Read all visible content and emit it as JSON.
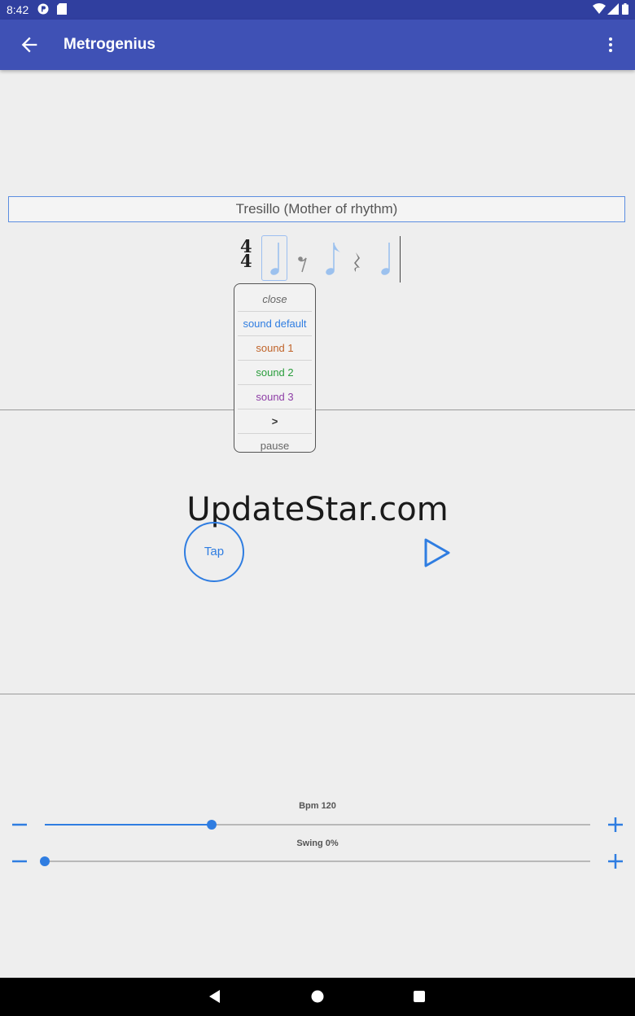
{
  "status_bar": {
    "time": "8:42"
  },
  "app_bar": {
    "title": "Metrogenius"
  },
  "rhythm": {
    "name": "Tresillo (Mother of rhythm)",
    "time_signature": {
      "top": "4",
      "bottom": "4"
    }
  },
  "sound_menu": {
    "items": [
      {
        "label": "close",
        "color": "#666666"
      },
      {
        "label": "sound default",
        "color": "#2f7de1"
      },
      {
        "label": "sound 1",
        "color": "#c0642a"
      },
      {
        "label": "sound 2",
        "color": "#2a9d3c"
      },
      {
        "label": "sound 3",
        "color": "#8e3ea6"
      },
      {
        "label": ">",
        "color": "#333333"
      },
      {
        "label": "pause",
        "color": "#666666"
      }
    ]
  },
  "watermark": "UpdateStar.com",
  "controls": {
    "tap_label": "Tap"
  },
  "sliders": {
    "bpm": {
      "label": "Bpm 120",
      "fraction": 0.306
    },
    "swing": {
      "label": "Swing 0%",
      "fraction": 0.0
    }
  },
  "colors": {
    "primary": "#3f51b5",
    "primary_dark": "#303f9f",
    "accent": "#2f7de1"
  }
}
